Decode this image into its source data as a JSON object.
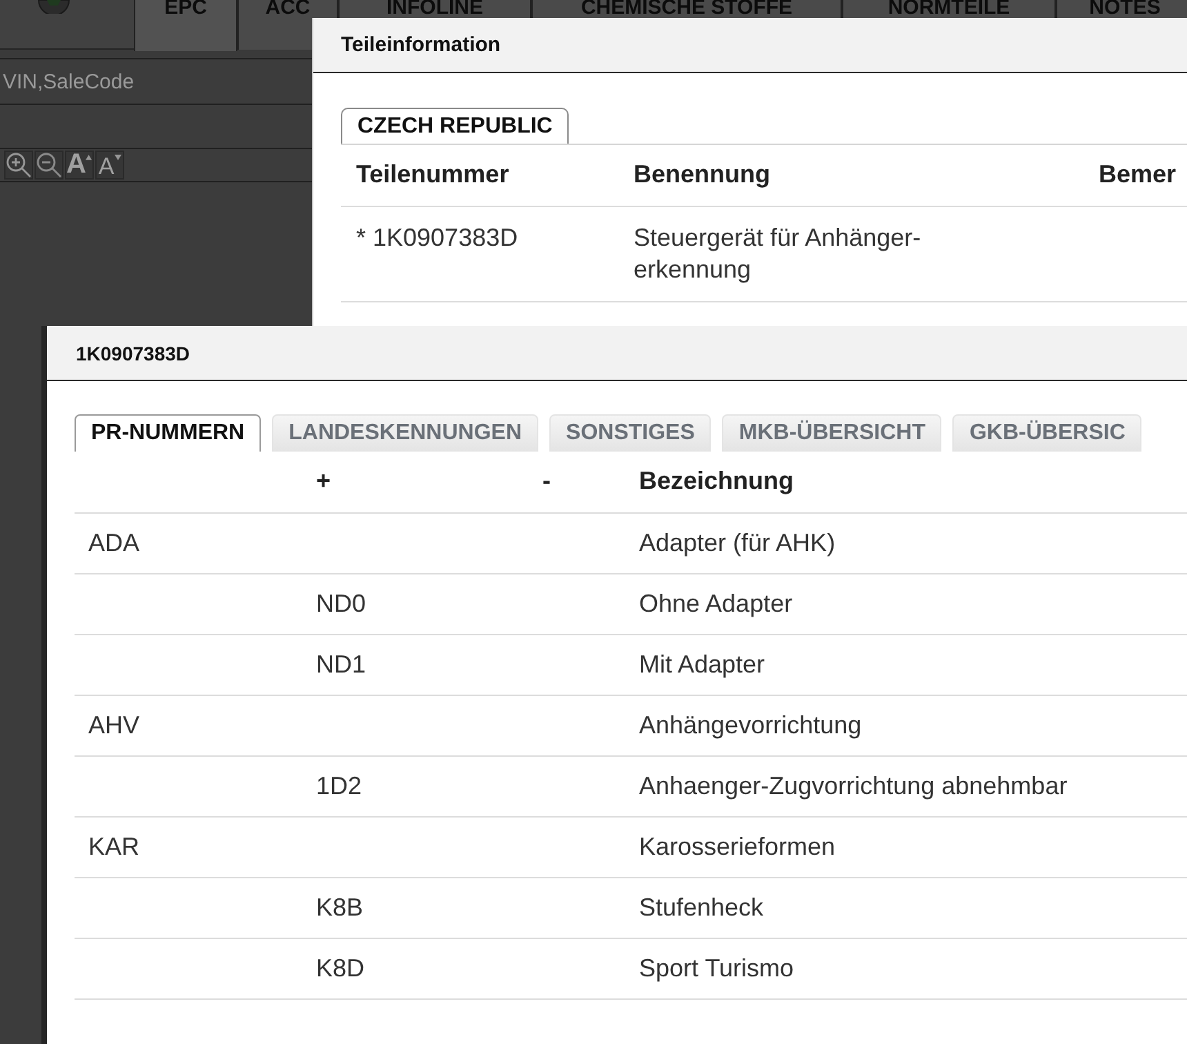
{
  "app": {
    "tabs": [
      {
        "label": "EPC",
        "selected": true
      },
      {
        "label": "ACC",
        "selected": false
      },
      {
        "label": "INFOLINE",
        "selected": false
      },
      {
        "label": "CHEMISCHE STOFFE",
        "selected": false
      },
      {
        "label": "NORMTEILE",
        "selected": false
      },
      {
        "label": "NOTES",
        "selected": false
      }
    ],
    "search": {
      "placeholder": "VIN,SaleCode"
    },
    "toolbar": [
      {
        "kind": "zoom-in"
      },
      {
        "kind": "zoom-out"
      },
      {
        "kind": "font-larger",
        "label": "A"
      },
      {
        "kind": "font-smaller",
        "label": "A"
      }
    ]
  },
  "parts_dialog": {
    "title": "Teileinformation",
    "tabs": [
      {
        "label": "CZECH REPUBLIC",
        "selected": true
      }
    ],
    "table": {
      "columns": {
        "teilenummer": "Teilenummer",
        "benennung": "Benennung",
        "column_3": "Bemer"
      },
      "rows": [
        {
          "teilenummer": "* 1K0907383D",
          "benennung": "Steuergerät für Anhänger-erkennung"
        }
      ]
    }
  },
  "detail_dialog": {
    "title": "1K0907383D",
    "tabs": [
      {
        "label": "PR-NUMMERN",
        "selected": true
      },
      {
        "label": "LANDESKENNUNGEN",
        "selected": false
      },
      {
        "label": "SONSTIGES",
        "selected": false
      },
      {
        "label": "MKB-ÜBERSICHT",
        "selected": false
      },
      {
        "label": "GKB-ÜBERSIC",
        "selected": false
      }
    ],
    "table": {
      "columns": {
        "plus": "+",
        "minus": "-",
        "bezeichnung": "Bezeichnung"
      },
      "rows": [
        {
          "column_1": "ADA",
          "bezeichnung": "Adapter (für AHK)"
        },
        {
          "plus": "ND0",
          "bezeichnung": "Ohne Adapter"
        },
        {
          "plus": "ND1",
          "bezeichnung": "Mit Adapter"
        },
        {
          "column_1": "AHV",
          "bezeichnung": "Anhängevorrichtung"
        },
        {
          "plus": "1D2",
          "bezeichnung": "Anhaenger-Zugvorrichtung abnehmbar"
        },
        {
          "column_1": "KAR",
          "bezeichnung": "Karosserieformen"
        },
        {
          "plus": "K8B",
          "bezeichnung": "Stufenheck"
        },
        {
          "plus": "K8D",
          "bezeichnung": "Sport Turismo"
        }
      ]
    }
  }
}
